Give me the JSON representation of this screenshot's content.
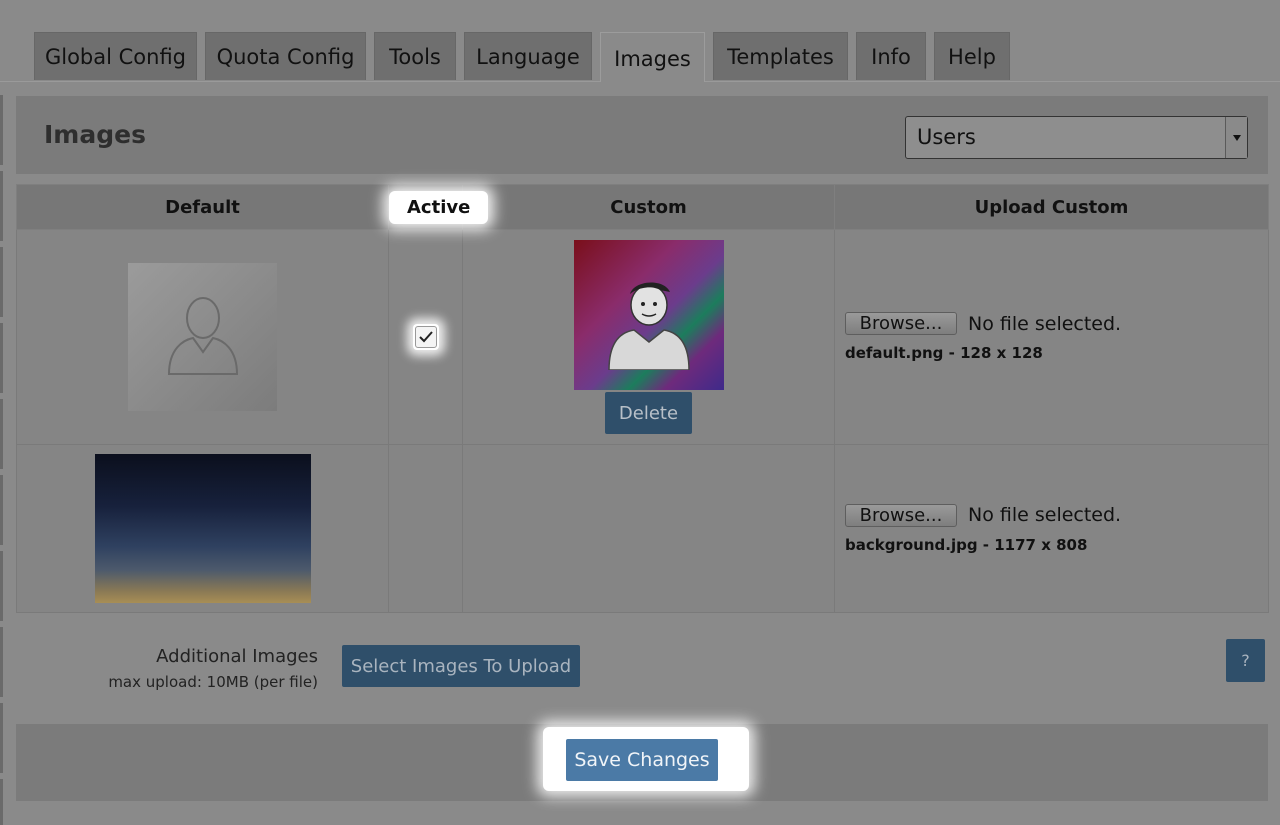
{
  "tabs": [
    {
      "label": "Global Config",
      "active": false
    },
    {
      "label": "Quota Config",
      "active": false
    },
    {
      "label": "Tools",
      "active": false
    },
    {
      "label": "Language",
      "active": false
    },
    {
      "label": "Images",
      "active": true
    },
    {
      "label": "Templates",
      "active": false
    },
    {
      "label": "Info",
      "active": false
    },
    {
      "label": "Help",
      "active": false
    }
  ],
  "header": {
    "title": "Images",
    "select_value": "Users"
  },
  "table": {
    "columns": [
      "Default",
      "Active",
      "Custom",
      "Upload Custom"
    ],
    "rows": [
      {
        "default_image": "user-avatar-placeholder",
        "active": true,
        "custom_image": "custom-avatar",
        "delete_label": "Delete",
        "browse_label": "Browse...",
        "file_status": "No file selected.",
        "file_info": "default.png - 128 x 128"
      },
      {
        "default_image": "background-image",
        "active": null,
        "custom_image": null,
        "browse_label": "Browse...",
        "file_status": "No file selected.",
        "file_info": "background.jpg - 1177 x 808"
      }
    ]
  },
  "additional": {
    "title": "Additional Images",
    "subtitle": "max upload: 10MB (per file)",
    "button_label": "Select Images To Upload",
    "help_label": "?"
  },
  "footer": {
    "save_label": "Save Changes"
  },
  "colors": {
    "primary_button": "#4b7aa6",
    "dim_button": "#2f4f6a",
    "overlay_bg": "#8a8a8a"
  }
}
